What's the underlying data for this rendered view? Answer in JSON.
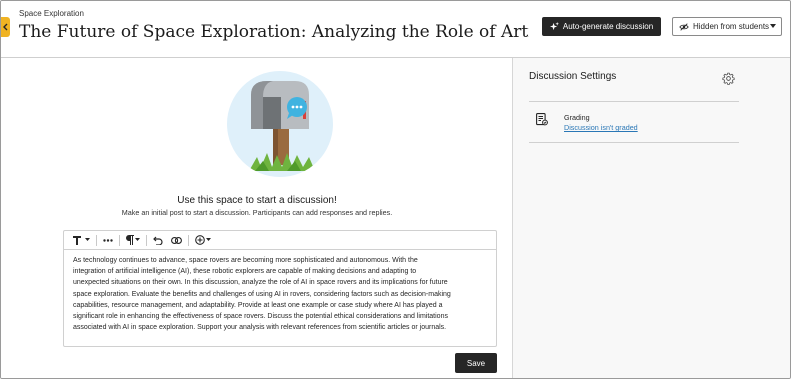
{
  "header": {
    "breadcrumb": "Space Exploration",
    "title": "The Future of Space Exploration: Analyzing the Role of Artificial ...",
    "auto_generate_label": "Auto-generate discussion",
    "visibility_label": "Hidden from students"
  },
  "main": {
    "empty_title": "Use this space to start a discussion!",
    "empty_subtitle": "Make an initial post to start a discussion. Participants can add responses and replies.",
    "editor_lines": [
      "As technology continues to advance, space rovers are becoming more sophisticated and autonomous. With the",
      "integration of artificial intelligence (AI), these robotic explorers are capable of making decisions and adapting to",
      "unexpected situations on their own. In this discussion, analyze the role of AI in space rovers and its implications for future",
      "space exploration. Evaluate the benefits and challenges of using AI in rovers, considering factors such as decision-making",
      "capabilities, resource management, and adaptability. Provide at least one example or case study where AI has played a",
      "significant role in enhancing the effectiveness of space rovers. Discuss the potential ethical considerations and limitations",
      "associated with AI in space exploration. Support your analysis with relevant references from scientific articles or journals."
    ],
    "save_label": "Save"
  },
  "settings": {
    "title": "Discussion Settings",
    "grading_label": "Grading",
    "grading_value": "Discussion isn't graded"
  },
  "colors": {
    "accent_tab": "#f0b323",
    "dark_button": "#262626",
    "link": "#2a77b6"
  },
  "icons": [
    "back-arrow-icon",
    "sparkle-icon",
    "eye-slash-icon",
    "chevron-down-icon",
    "text-format-icon",
    "more-icon",
    "paragraph-icon",
    "undo-icon",
    "link-icon",
    "insert-icon",
    "gear-icon",
    "grading-icon",
    "mailbox-illustration"
  ]
}
